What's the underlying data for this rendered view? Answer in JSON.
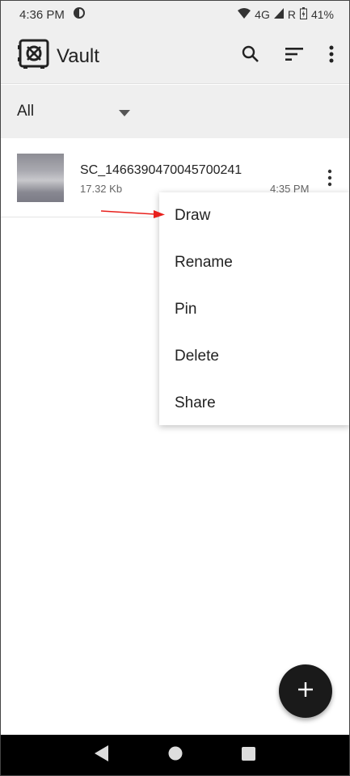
{
  "status_bar": {
    "time": "4:36 PM",
    "network": "4G",
    "roaming": "R",
    "battery": "41%"
  },
  "app_bar": {
    "title": "Vault",
    "icons": [
      "vault-logo-icon",
      "search-icon",
      "sort-icon",
      "more-vert-icon"
    ]
  },
  "filter": {
    "selected": "All"
  },
  "files": [
    {
      "name": "SC_1466390470045700241",
      "size": "17.32 Kb",
      "time": "4:35 PM"
    }
  ],
  "context_menu": {
    "items": [
      "Draw",
      "Rename",
      "Pin",
      "Delete",
      "Share"
    ]
  },
  "fab": {
    "icon": "add-icon"
  },
  "nav": {
    "icons": [
      "back-icon",
      "home-icon",
      "recents-icon"
    ]
  },
  "colors": {
    "annotation_arrow": "#e8201c",
    "fab": "#1a1a1a"
  }
}
